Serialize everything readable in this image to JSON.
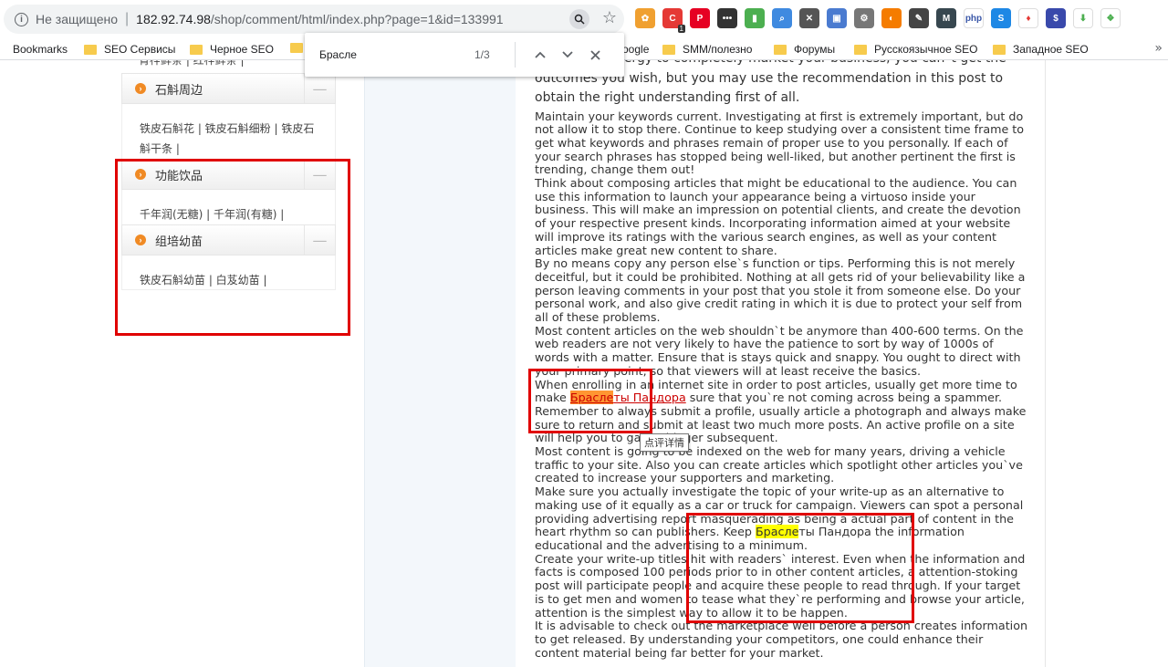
{
  "browser": {
    "security_label": "Не защищено",
    "url_host": "182.92.74.98",
    "url_path": "/shop/comment/html/index.php?page=1&id=133991",
    "ext_badge": "1"
  },
  "extensions": [
    {
      "icon": "extension-flower-icon",
      "color": "#f0a030",
      "glyph": "✿"
    },
    {
      "icon": "extension-red-shield-icon",
      "color": "#e53935",
      "glyph": "C"
    },
    {
      "icon": "pinterest-icon",
      "color": "#e60023",
      "glyph": "P"
    },
    {
      "icon": "extension-dots-icon",
      "color": "#333333",
      "glyph": "•••"
    },
    {
      "icon": "extension-bars-icon",
      "color": "#4caf50",
      "glyph": "▮"
    },
    {
      "icon": "extension-magnifier-icon",
      "color": "#3f8ae0",
      "glyph": "⌕"
    },
    {
      "icon": "extension-tools-icon",
      "color": "#555555",
      "glyph": "✕"
    },
    {
      "icon": "extension-screen-icon",
      "color": "#4a7bd0",
      "glyph": "▣"
    },
    {
      "icon": "extension-gear-icon",
      "color": "#777777",
      "glyph": "⚙"
    },
    {
      "icon": "extension-circle-icon",
      "color": "#f57c00",
      "glyph": "◐"
    },
    {
      "icon": "extension-edit-icon",
      "color": "#444444",
      "glyph": "✎"
    },
    {
      "icon": "extension-m-icon",
      "color": "#37474f",
      "glyph": "M"
    },
    {
      "icon": "extension-php-icon",
      "color": "#ffffff",
      "glyph": "php",
      "text_color": "#3a57a8"
    },
    {
      "icon": "extension-s-icon",
      "color": "#1e88e5",
      "glyph": "S"
    },
    {
      "icon": "extension-pin-icon",
      "color": "#ffffff",
      "glyph": "♦",
      "text_color": "#e53935"
    },
    {
      "icon": "extension-dollar-icon",
      "color": "#3949ab",
      "glyph": "$"
    },
    {
      "icon": "extension-down-arrow-icon",
      "color": "#ffffff",
      "glyph": "⬇",
      "text_color": "#4caf50"
    },
    {
      "icon": "extension-puzzle-icon",
      "color": "#ffffff",
      "glyph": "❖",
      "text_color": "#4caf50"
    }
  ],
  "bookmarks": [
    {
      "label": "Bookmarks",
      "kind": "apps"
    },
    {
      "label": "SEO Сервисы",
      "kind": "folder"
    },
    {
      "label": "Черное SEO",
      "kind": "folder"
    },
    {
      "label": "",
      "kind": "folder"
    },
    {
      "label": "oogle",
      "kind": "none"
    },
    {
      "label": "SMM/полезно",
      "kind": "folder"
    },
    {
      "label": "Форумы",
      "kind": "folder"
    },
    {
      "label": "Русскоязычное SEO",
      "kind": "folder"
    },
    {
      "label": "Западное SEO",
      "kind": "folder"
    }
  ],
  "find": {
    "query": "Брасле",
    "count": "1/3"
  },
  "sidebar": {
    "top_text": "青梓鲜条 | 红梓鲜条 |",
    "categories": [
      {
        "title": "石斛周边",
        "items": "铁皮石斛花 | 铁皮石斛细粉 | 铁皮石斛干条 |"
      },
      {
        "title": "功能饮品",
        "items": "千年润(无糖) | 千年润(有糖) |"
      },
      {
        "title": "组培幼苗",
        "items": "铁皮石斛幼苗 | 白芨幼苗 |"
      }
    ]
  },
  "article": {
    "lead": "devote the energy to completely market your business, you can`t get the outcomes you wish, but you may use the recommendation in this post to obtain the right understanding first of all.",
    "p1": "Maintain your keywords current. Investigating at first is extremely important, but do not allow it to stop there. Continue to keep studying over a consistent time frame to get what keywords and phrases remain of proper use to you personally. If each of your search phrases has stopped being well-liked, but another pertinent the first is trending, change them out!",
    "p2": "Think about composing articles that might be educational to the audience. You can use this information to launch your appearance being a virtuoso inside your business. This will make an impression on potential clients, and create the devotion of your respective present kinds. Incorporating information aimed at your website will improve its ratings with the various search engines, as well as your content articles make great new content to share.",
    "p3": "By no means copy any person else`s function or tips. Performing this is not merely deceitful, but it could be prohibited. Nothing at all gets rid of your believability like a person leaving comments in your post that you stole it from someone else. Do your personal work, and also give credit rating in which it is due to protect your self from all of these problems.",
    "p4": "Most content articles on the web shouldn`t be anymore than 400-600 terms. On the web readers are not very likely to have the patience to sort by way of 1000s of words with a matter. Ensure that is stays quick and snappy. You ought to direct with your primary point, so that viewers will at least receive the basics.",
    "p5_before": "When enrolling in an internet site in order to post articles, usually get more time to make ",
    "p5_hl": "Брасле",
    "p5_link_rest": "ты Пандора",
    "p5_after": " sure that you`re not coming across being a spammer. Remember to always submit a profile, usually article a photograph and always make sure to return and submit at least two much more posts. An active profile on a site will help you to gain a bigger subsequent.",
    "p6": "Most content is going to be indexed on the web for many years, driving a vehicle traffic to your site. Also you can create articles which spotlight other articles you`ve created to increase your supporters and marketing.",
    "p7_before": "Make sure you actually investigate the topic of your write-up as an alternative to making use of it equally as a car or truck for campaign. Viewers can spot a personal providing advertising report masquerading as being a actual part of content in the heart rhythm so can publishers. Keep ",
    "p7_hl": "Брасле",
    "p7_after": "ты Пандора the information educational and the advertising to a minimum.",
    "p8": "Create your write-up titles hit with readers` interest. Even when the information and facts is composed 100 periods prior to in other content articles, a attention-stoking post will participate people and acquire these people to read through. If your target is to get men and women to tease what they`re performing and browse your article, attention is the simplest way to allow it to be happen.",
    "p9": "It is advisable to check out the marketplace well before a person creates information to get released. By understanding your competitors, one could enhance their content material being far better for your market."
  },
  "tooltip": "点评详情",
  "colors": {
    "highlight_active": "#ff9632",
    "highlight": "#ffff00",
    "annotation_red": "#e00000",
    "link": "#cc0000"
  }
}
